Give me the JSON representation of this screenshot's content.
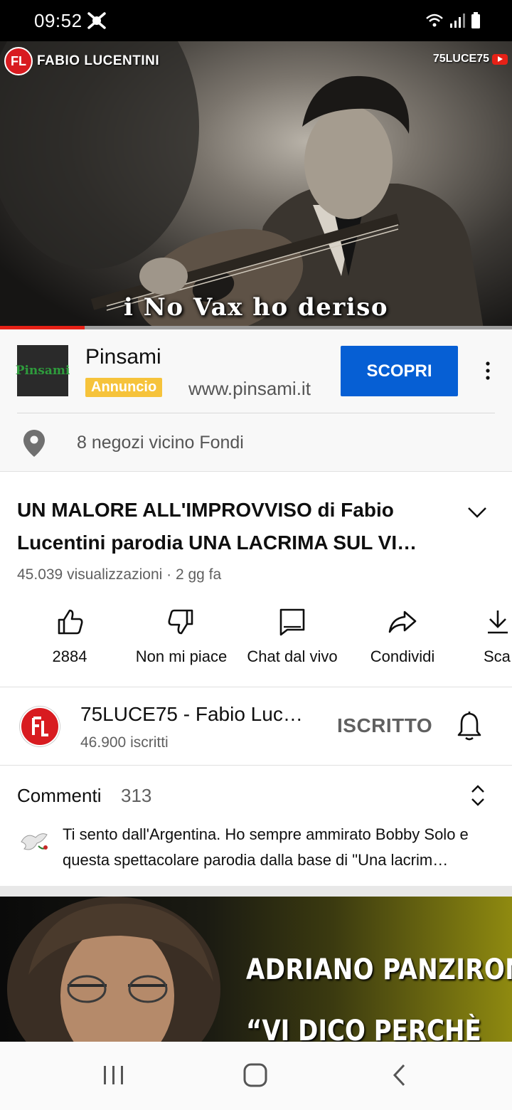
{
  "status_bar": {
    "time": "09:52"
  },
  "player": {
    "channel_watermark": "FABIO LUCENTINI",
    "channel_tag": "75LUCE75",
    "caption": "i No Vax ho deriso",
    "progress_fraction": 0.165,
    "progress_color": "#e62117"
  },
  "ad": {
    "logo_text": "Pinsami",
    "name": "Pinsami",
    "badge": "Annuncio",
    "url": "www.pinsami.it",
    "cta": "SCOPRI",
    "location": "8 negozi vicino Fondi",
    "cta_color": "#065fd4",
    "badge_color": "#f6c33b"
  },
  "video": {
    "title": "UN MALORE ALL'IMPROVVISO di Fabio Lucentini parodia UNA LACRIMA SUL VI…",
    "meta": "45.039 visualizzazioni · 2 gg fa",
    "actions": [
      {
        "label": "2884",
        "icon": "thumbs-up-icon"
      },
      {
        "label": "Non mi piace",
        "icon": "thumbs-down-icon"
      },
      {
        "label": "Chat dal vivo",
        "icon": "chat-icon"
      },
      {
        "label": "Condividi",
        "icon": "share-icon"
      },
      {
        "label": "Sca",
        "icon": "download-icon"
      }
    ]
  },
  "channel": {
    "name": "75LUCE75 - Fabio Luc…",
    "subscribers": "46.900 iscritti",
    "subscribe_state": "ISCRITTO"
  },
  "comments": {
    "heading": "Commenti",
    "count": "313",
    "top_comment": "Ti sento dall'Argentina. Ho sempre ammirato Bobby Solo e questa spettacolare parodia dalla base di \"Una lacrim…"
  },
  "next_video": {
    "line1": "ADRIANO PANZIRONI",
    "line2": "“VI DICO PERCHÈ"
  }
}
